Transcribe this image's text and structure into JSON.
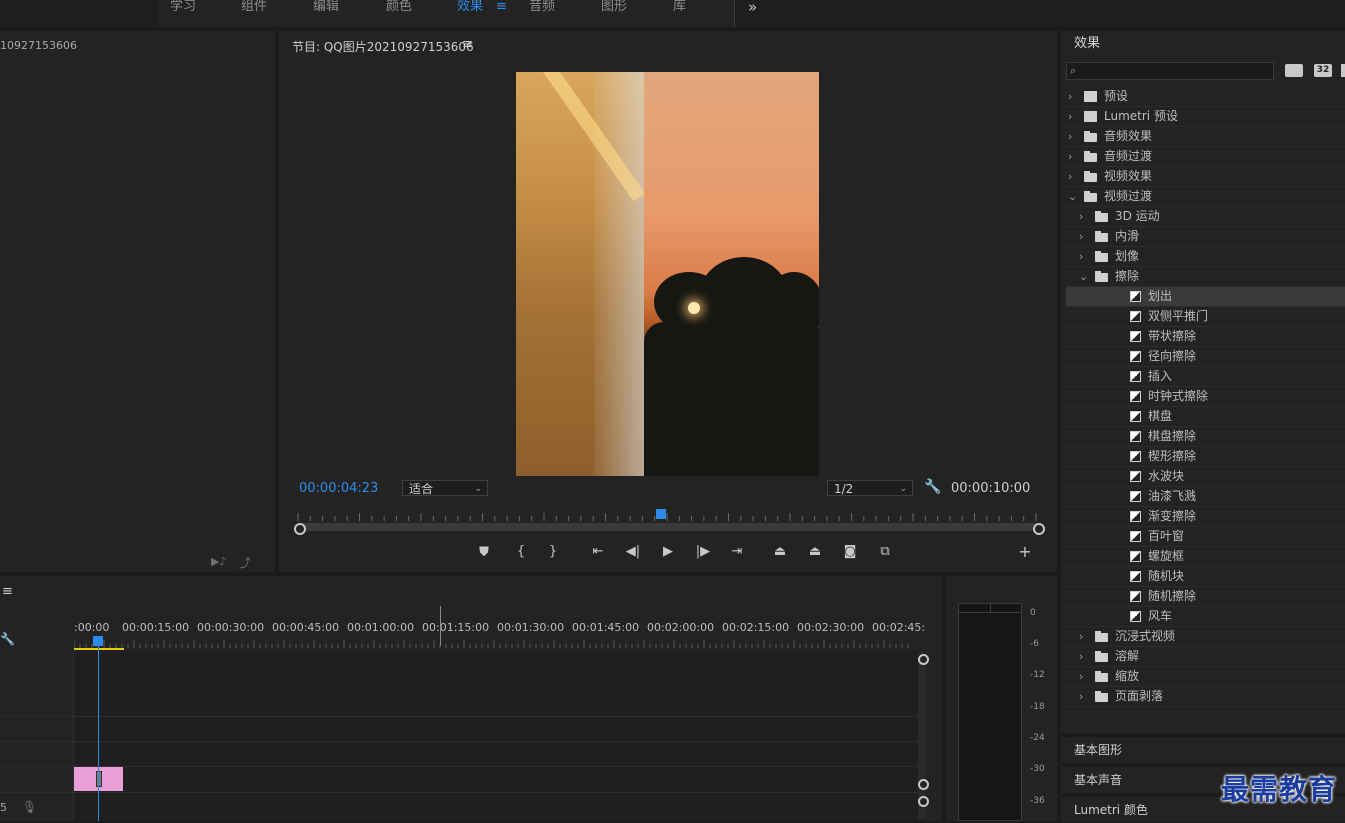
{
  "workspace_tabs": [
    "学习",
    "组件",
    "编辑",
    "颜色",
    "效果",
    "音频",
    "图形",
    "库"
  ],
  "active_tab": "效果",
  "source_panel": {
    "title": "10927153606"
  },
  "program": {
    "title": "节目: QQ图片20210927153606",
    "timecode_current": "00:00:04:23",
    "fit_value": "适合",
    "resolution_value": "1/2",
    "timecode_duration": "00:00:10:00",
    "playhead_fraction": 0.49
  },
  "timeline": {
    "ruler_labels": [
      ":00:00",
      "00:00:15:00",
      "00:00:30:00",
      "00:00:45:00",
      "00:01:00:00",
      "00:01:15:00",
      "00:01:30:00",
      "00:01:45:00",
      "00:02:00:00",
      "00:02:15:00",
      "00:02:30:00",
      "00:02:45:"
    ],
    "track_label": "5",
    "clip_color": "#e89fd8"
  },
  "meter": {
    "labels": [
      "0",
      "-6",
      "-12",
      "-18",
      "-24",
      "-30",
      "-36"
    ]
  },
  "effects": {
    "title": "效果",
    "search_placeholder": "",
    "toolbar_icons": [
      "32"
    ],
    "tree": [
      {
        "label": "预设",
        "kind": "preset",
        "level": 0,
        "expanded": false
      },
      {
        "label": "Lumetri 预设",
        "kind": "preset",
        "level": 0,
        "expanded": false
      },
      {
        "label": "音频效果",
        "kind": "folder",
        "level": 0,
        "expanded": false
      },
      {
        "label": "音频过渡",
        "kind": "folder",
        "level": 0,
        "expanded": false
      },
      {
        "label": "视频效果",
        "kind": "folder",
        "level": 0,
        "expanded": false
      },
      {
        "label": "视频过渡",
        "kind": "folder",
        "level": 0,
        "expanded": true
      },
      {
        "label": "3D 运动",
        "kind": "folder",
        "level": 1,
        "expanded": false
      },
      {
        "label": "内滑",
        "kind": "folder",
        "level": 1,
        "expanded": false
      },
      {
        "label": "划像",
        "kind": "folder",
        "level": 1,
        "expanded": false
      },
      {
        "label": "擦除",
        "kind": "folder",
        "level": 1,
        "expanded": true
      },
      {
        "label": "划出",
        "kind": "transition",
        "level": 2,
        "selected": true
      },
      {
        "label": "双侧平推门",
        "kind": "transition",
        "level": 2
      },
      {
        "label": "带状擦除",
        "kind": "transition",
        "level": 2
      },
      {
        "label": "径向擦除",
        "kind": "transition",
        "level": 2
      },
      {
        "label": "插入",
        "kind": "transition",
        "level": 2
      },
      {
        "label": "时钟式擦除",
        "kind": "transition",
        "level": 2
      },
      {
        "label": "棋盘",
        "kind": "transition",
        "level": 2
      },
      {
        "label": "棋盘擦除",
        "kind": "transition",
        "level": 2
      },
      {
        "label": "楔形擦除",
        "kind": "transition",
        "level": 2
      },
      {
        "label": "水波块",
        "kind": "transition",
        "level": 2
      },
      {
        "label": "油漆飞溅",
        "kind": "transition",
        "level": 2
      },
      {
        "label": "渐变擦除",
        "kind": "transition",
        "level": 2
      },
      {
        "label": "百叶窗",
        "kind": "transition",
        "level": 2
      },
      {
        "label": "螺旋框",
        "kind": "transition",
        "level": 2
      },
      {
        "label": "随机块",
        "kind": "transition",
        "level": 2
      },
      {
        "label": "随机擦除",
        "kind": "transition",
        "level": 2
      },
      {
        "label": "风车",
        "kind": "transition",
        "level": 2
      },
      {
        "label": "沉浸式视频",
        "kind": "folder",
        "level": 1,
        "expanded": false
      },
      {
        "label": "溶解",
        "kind": "folder",
        "level": 1,
        "expanded": false
      },
      {
        "label": "缩放",
        "kind": "folder",
        "level": 1,
        "expanded": false
      },
      {
        "label": "页面剥落",
        "kind": "folder",
        "level": 1,
        "expanded": false
      }
    ]
  },
  "bottom_panels": [
    "基本图形",
    "基本声音",
    "Lumetri 颜色"
  ],
  "watermark": "最需教育",
  "colors": {
    "accent": "#2d8ceb",
    "panel": "#232323",
    "background": "#1b1b1b"
  }
}
